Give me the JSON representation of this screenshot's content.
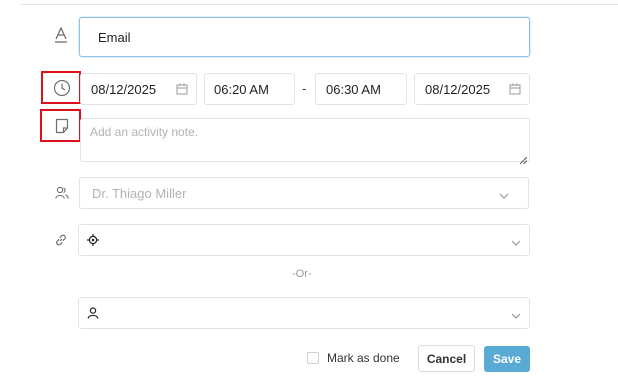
{
  "activity_type": {
    "value": "Email",
    "icon": "text-format-icon"
  },
  "schedule": {
    "icon": "clock-icon",
    "start_date": "08/12/2025",
    "start_time": "06:20 AM",
    "separator": "-",
    "end_time": "06:30 AM",
    "end_date": "08/12/2025",
    "calendar_icon": "calendar-icon"
  },
  "note": {
    "icon": "note-icon",
    "placeholder": "Add an activity note."
  },
  "assignee": {
    "icon": "users-icon",
    "placeholder": "Dr. Thiago Miller"
  },
  "deal": {
    "icon": "link-icon",
    "field_icon": "target-icon"
  },
  "divider_text": "-Or-",
  "contact": {
    "field_icon": "person-icon"
  },
  "footer": {
    "mark_as_done_label": "Mark as done",
    "cancel_label": "Cancel",
    "save_label": "Save"
  },
  "colors": {
    "focus_border": "#8fc2ea",
    "highlight": "#d9121b",
    "save_button": "#5aaad6"
  }
}
